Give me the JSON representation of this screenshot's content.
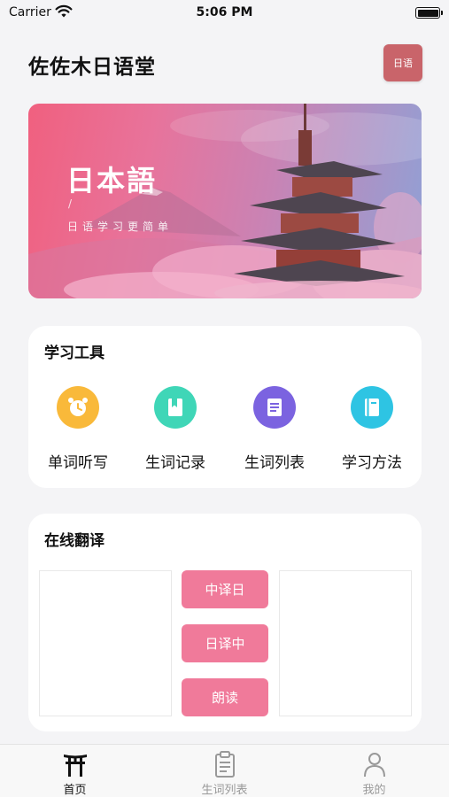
{
  "status_bar": {
    "carrier": "Carrier",
    "time": "5:06 PM"
  },
  "header": {
    "title": "佐佐木日语堂",
    "lang_button": "日语"
  },
  "banner": {
    "title": "日本語",
    "slash": "/",
    "subtitle": "日语学习更简单"
  },
  "tools": {
    "title": "学习工具",
    "items": [
      {
        "label": "单词听写",
        "icon": "alarm-clock-icon",
        "color": "#f9b93a"
      },
      {
        "label": "生词记录",
        "icon": "bookmark-icon",
        "color": "#3fd6b7"
      },
      {
        "label": "生词列表",
        "icon": "document-list-icon",
        "color": "#7b63e0"
      },
      {
        "label": "学习方法",
        "icon": "book-icon",
        "color": "#2ec4e3"
      }
    ]
  },
  "translate": {
    "title": "在线翻译",
    "buttons": {
      "zh_to_ja": "中译日",
      "ja_to_zh": "日译中",
      "read_aloud": "朗读"
    }
  },
  "tabbar": {
    "items": [
      {
        "label": "首页",
        "icon": "torii-gate-icon",
        "active": true
      },
      {
        "label": "生词列表",
        "icon": "clipboard-icon",
        "active": false
      },
      {
        "label": "我的",
        "icon": "user-icon",
        "active": false
      }
    ],
    "active_color": "#111111",
    "inactive_color": "#999999"
  }
}
